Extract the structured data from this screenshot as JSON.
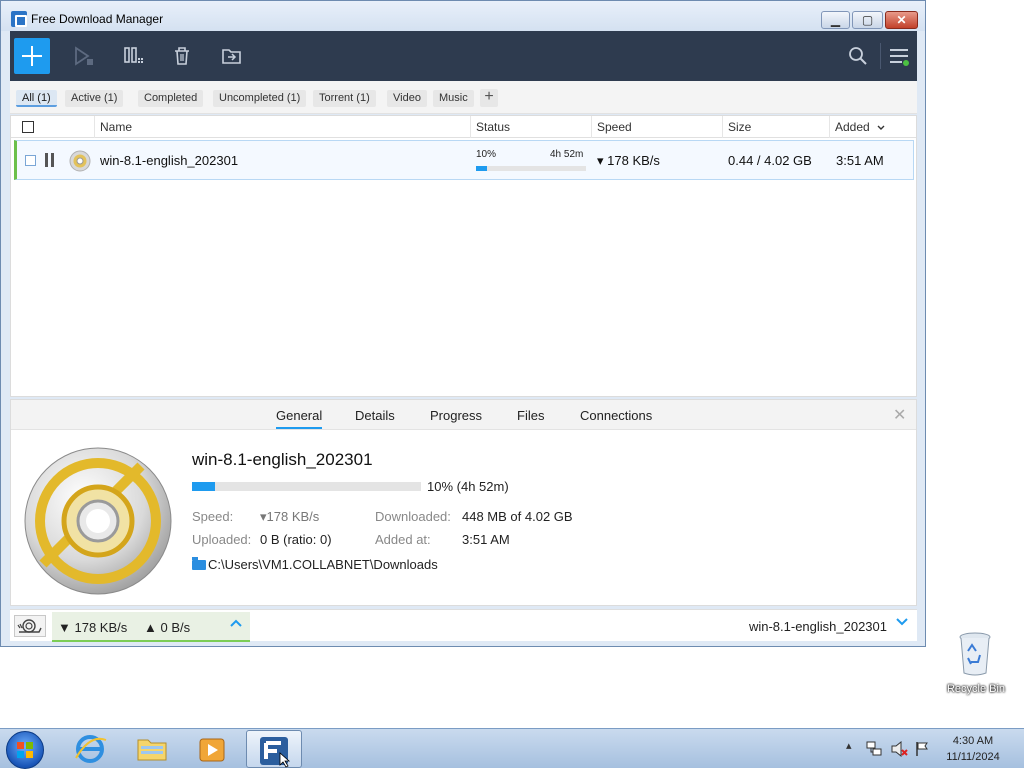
{
  "window": {
    "title": "Free Download Manager",
    "controls": {
      "minimize": "▁",
      "maximize": "▢",
      "close": "✕"
    }
  },
  "toolbar": {
    "icons": [
      "add-icon",
      "resume-icon",
      "pause-all-icon",
      "delete-icon",
      "move-icon",
      "search-icon",
      "menu-icon"
    ]
  },
  "filters": [
    "All (1)",
    "Active (1)",
    "Completed",
    "Uncompleted (1)",
    "Torrent (1)",
    "Video",
    "Music"
  ],
  "filter_add_label": "+",
  "columns": {
    "name": "Name",
    "status": "Status",
    "speed": "Speed",
    "size": "Size",
    "added": "Added"
  },
  "downloads": [
    {
      "name": "win-8.1-english_202301",
      "progress_percent": "10%",
      "progress_fraction": 0.1,
      "eta": "4h 52m",
      "speed": "▾ 178 KB/s",
      "size": "0.44 / 4.02 GB",
      "added": "3:51 AM"
    }
  ],
  "details": {
    "tabs": [
      "General",
      "Details",
      "Progress",
      "Files",
      "Connections"
    ],
    "name": "win-8.1-english_202301",
    "progress_text": "10% (4h 52m)",
    "speed_label": "Speed:",
    "speed_value": "▾178 KB/s",
    "uploaded_label": "Uploaded:",
    "uploaded_value": "0 B (ratio: 0)",
    "downloaded_label": "Downloaded:",
    "downloaded_value": "448 MB of 4.02 GB",
    "added_label": "Added at:",
    "added_value": "3:51 AM",
    "path": "C:\\Users\\VM1.COLLABNET\\Downloads",
    "close": "✕"
  },
  "statusbar": {
    "download_speed": "▼ 178 KB/s",
    "upload_speed": "▲ 0 B/s",
    "current_name": "win-8.1-english_202301"
  },
  "desktop": {
    "recycle_bin_label": "Recycle Bin"
  },
  "taskbar": {
    "clock_time": "4:30 AM",
    "clock_date": "11/11/2024",
    "tray_expand": "▴"
  },
  "colors": {
    "accent": "#1e9bef",
    "toolbar_bg": "#2e3b4f",
    "progress": "#1e9bef",
    "active_green": "#6cc04a"
  }
}
